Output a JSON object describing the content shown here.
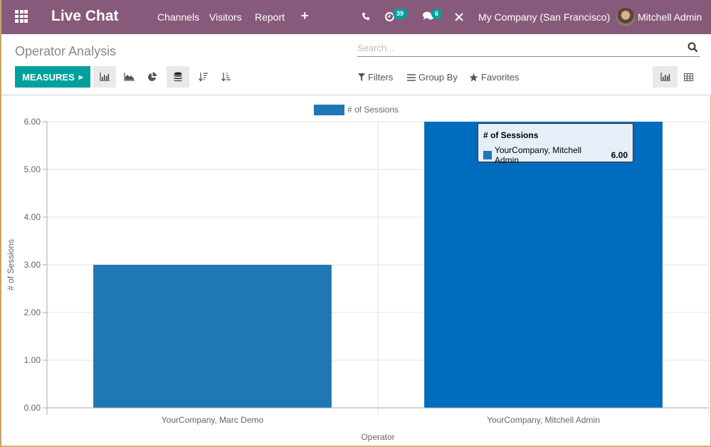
{
  "navbar": {
    "app_name": "Live Chat",
    "menu": [
      "Channels",
      "Visitors",
      "Report"
    ],
    "activity_badge": "39",
    "messages_badge": "6",
    "company": "My Company (San Francisco)",
    "user": "Mitchell Admin"
  },
  "control_panel": {
    "title": "Operator Analysis",
    "search_placeholder": "Search...",
    "measures_label": "MEASURES",
    "filters_label": "Filters",
    "groupby_label": "Group By",
    "favorites_label": "Favorites"
  },
  "colors": {
    "navbar": "#875a7b",
    "primary": "#00a09d",
    "bar_default": "#1f77b4",
    "bar_hover": "#006cbd"
  },
  "chart_data": {
    "type": "bar",
    "title": "",
    "categories": [
      "YourCompany, Marc Demo",
      "YourCompany, Mitchell Admin"
    ],
    "series": [
      {
        "name": "# of Sessions",
        "values": [
          3,
          6
        ]
      }
    ],
    "xlabel": "Operator",
    "ylabel": "# of Sessions",
    "ylim": [
      0,
      6
    ],
    "yticks": [
      "0.00",
      "1.00",
      "2.00",
      "3.00",
      "4.00",
      "5.00",
      "6.00"
    ],
    "grid": true,
    "legend": "top-center",
    "hovered_index": 1,
    "tooltip": {
      "title": "# of Sessions",
      "label": "YourCompany, Mitchell Admin",
      "value": "6.00"
    }
  }
}
